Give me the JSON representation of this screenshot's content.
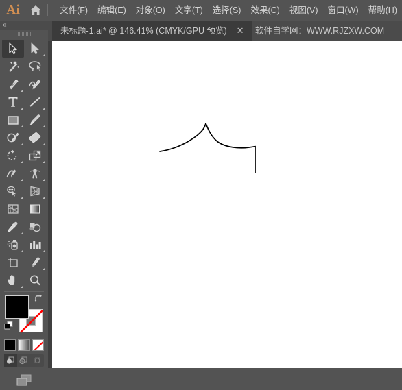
{
  "app": {
    "logo_text": "Ai",
    "home_icon": "home-icon"
  },
  "menubar": {
    "items": [
      {
        "label": "文件(F)",
        "name": "menu-file"
      },
      {
        "label": "编辑(E)",
        "name": "menu-edit"
      },
      {
        "label": "对象(O)",
        "name": "menu-object"
      },
      {
        "label": "文字(T)",
        "name": "menu-type"
      },
      {
        "label": "选择(S)",
        "name": "menu-select"
      },
      {
        "label": "效果(C)",
        "name": "menu-effect"
      },
      {
        "label": "视图(V)",
        "name": "menu-view"
      },
      {
        "label": "窗口(W)",
        "name": "menu-window"
      },
      {
        "label": "帮助(H)",
        "name": "menu-help"
      }
    ]
  },
  "tabbar": {
    "tab_title": "未标题-1.ai* @ 146.41% (CMYK/GPU 预览)",
    "close_label": "✕",
    "watermark": "软件自学网：WWW.RJZXW.COM"
  },
  "toolpanel": {
    "collapse_label": "«",
    "tools": [
      {
        "name": "selection-tool",
        "active": true,
        "corner": false
      },
      {
        "name": "direct-selection-tool",
        "active": false,
        "corner": true
      },
      {
        "name": "magic-wand-tool",
        "active": false,
        "corner": false
      },
      {
        "name": "lasso-tool",
        "active": false,
        "corner": false
      },
      {
        "name": "pen-tool",
        "active": false,
        "corner": true
      },
      {
        "name": "curvature-tool",
        "active": false,
        "corner": false
      },
      {
        "name": "type-tool",
        "active": false,
        "corner": true
      },
      {
        "name": "line-segment-tool",
        "active": false,
        "corner": true
      },
      {
        "name": "rectangle-tool",
        "active": false,
        "corner": true
      },
      {
        "name": "paintbrush-tool",
        "active": false,
        "corner": true
      },
      {
        "name": "shaper-pencil-tool",
        "active": false,
        "corner": true
      },
      {
        "name": "eraser-tool",
        "active": false,
        "corner": true
      },
      {
        "name": "rotate-tool",
        "active": false,
        "corner": true
      },
      {
        "name": "scale-tool",
        "active": false,
        "corner": true
      },
      {
        "name": "width-tool",
        "active": false,
        "corner": true
      },
      {
        "name": "free-transform-tool",
        "active": false,
        "corner": true
      },
      {
        "name": "shape-builder-tool",
        "active": false,
        "corner": true
      },
      {
        "name": "perspective-grid-tool",
        "active": false,
        "corner": true
      },
      {
        "name": "mesh-tool",
        "active": false,
        "corner": false
      },
      {
        "name": "gradient-tool",
        "active": false,
        "corner": false
      },
      {
        "name": "eyedropper-tool",
        "active": false,
        "corner": true
      },
      {
        "name": "blend-tool",
        "active": false,
        "corner": false
      },
      {
        "name": "symbol-sprayer-tool",
        "active": false,
        "corner": true
      },
      {
        "name": "column-graph-tool",
        "active": false,
        "corner": true
      },
      {
        "name": "artboard-tool",
        "active": false,
        "corner": false
      },
      {
        "name": "slice-tool",
        "active": false,
        "corner": true
      },
      {
        "name": "hand-tool",
        "active": false,
        "corner": true
      },
      {
        "name": "zoom-tool",
        "active": false,
        "corner": false
      }
    ],
    "color": {
      "fill_color": "#000000",
      "stroke_color": "#ffffff",
      "stroke_is_none": true,
      "none_slash_color": "#ff0000"
    },
    "fill_modes": [
      {
        "name": "color-mode-button",
        "label": "color"
      },
      {
        "name": "gradient-mode-button",
        "label": "gradient"
      },
      {
        "name": "none-mode-button",
        "label": "none"
      }
    ],
    "draw_modes": [
      {
        "name": "draw-normal-button",
        "active": true
      },
      {
        "name": "draw-behind-button",
        "active": false
      },
      {
        "name": "draw-inside-button",
        "active": false
      }
    ],
    "screen_mode": {
      "name": "change-screen-mode-button"
    }
  },
  "canvas": {
    "background": "#ffffff",
    "artwork": {
      "name": "roof-curve-path",
      "stroke_color": "#000000",
      "stroke_width": 1.6,
      "zoom_level": "146.41%",
      "paths": [
        "M 157 161 C 178 157 204 146 222 129 C 233 119 238 110 224 120",
        "M 224 120 C 234 131 243 145 255 150 C 268 156 283 157 296 154",
        "M 296 192 L 296 154"
      ]
    }
  }
}
